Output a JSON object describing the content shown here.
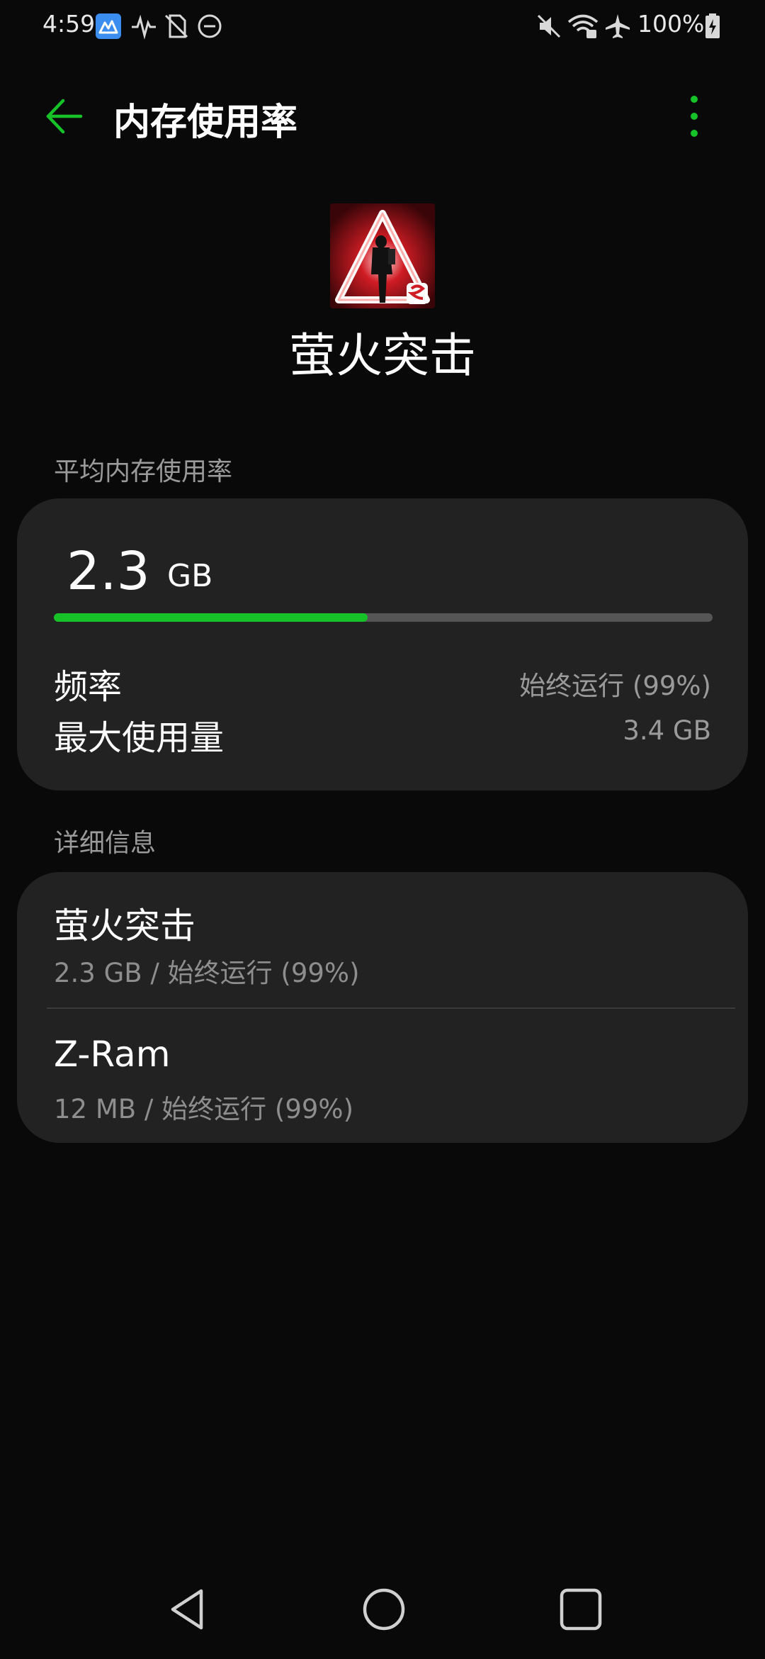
{
  "status_bar": {
    "time": "4:59",
    "battery": "100%",
    "left_icons": [
      "app-notification-icon",
      "activity-icon",
      "no-sim-icon",
      "do-not-disturb-icon"
    ],
    "right_icons": [
      "mute-icon",
      "wifi-icon",
      "airplane-mode-icon",
      "battery-charging-icon"
    ]
  },
  "app_bar": {
    "title": "内存使用率",
    "back_icon": "arrow-left-icon",
    "more_icon": "more-vertical-icon"
  },
  "app_header": {
    "name": "萤火突击"
  },
  "average_section": {
    "label": "平均内存使用率",
    "value": "2.3",
    "unit": "GB",
    "progress_fraction": 0.476,
    "frequency_label": "频率",
    "frequency_value": "始终运行 (99%)",
    "max_label": "最大使用量",
    "max_value": "3.4 GB"
  },
  "details_section": {
    "label": "详细信息",
    "items": [
      {
        "title": "萤火突击",
        "subtitle": "2.3 GB / 始终运行 (99%)"
      },
      {
        "title": "Z-Ram",
        "subtitle": "12 MB / 始终运行 (99%)"
      }
    ]
  },
  "colors": {
    "accent": "#17c228",
    "background": "#090909",
    "card": "#222222",
    "secondary_text": "#9a9a9a"
  },
  "nav_bar": {
    "icons": [
      "back-triangle-icon",
      "home-circle-icon",
      "recents-square-icon"
    ]
  }
}
